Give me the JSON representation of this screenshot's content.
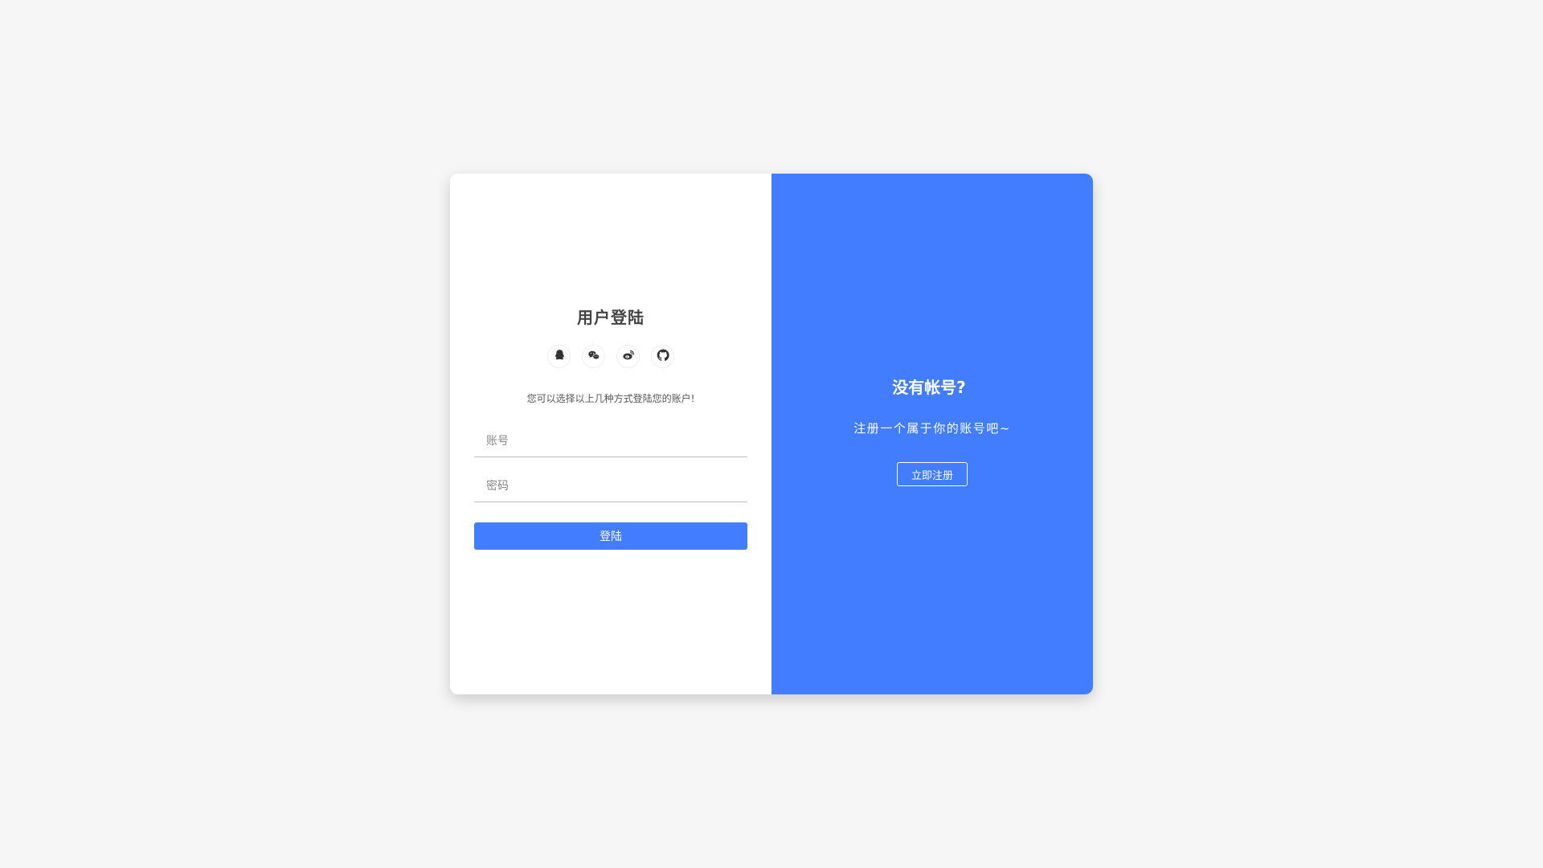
{
  "login": {
    "title": "用户登陆",
    "socials": [
      {
        "icon": "qq-icon"
      },
      {
        "icon": "wechat-icon"
      },
      {
        "icon": "weibo-icon"
      },
      {
        "icon": "github-icon"
      }
    ],
    "hint": "您可以选择以上几种方式登陆您的账户!",
    "account_placeholder": "账号",
    "password_placeholder": "密码",
    "submit_label": "登陆"
  },
  "register": {
    "title": "没有帐号?",
    "subtitle": "注册一个属于你的账号吧~",
    "button_label": "立即注册"
  },
  "colors": {
    "accent": "#417dfe",
    "page_background": "#f6f6f6",
    "card_left": "#ffffff"
  }
}
